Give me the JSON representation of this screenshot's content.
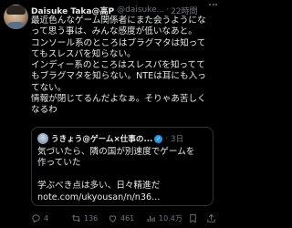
{
  "post": {
    "author_name": "Daisuke Taka@高P",
    "handle": "@daisuke...",
    "separator": "·",
    "time": "22時間",
    "lines": [
      "最近色んなゲーム関係者にまた会うようにな",
      "って思う事は、みんな感度が低いなあと。",
      "コンソール系のところはブラグマタは知って",
      "てもスレスパを知らない。",
      "インディー系のところはスレスパを知ってて",
      "もブラグマタを知らない。NTEは耳にも入っ",
      "てない。",
      "情報が閉じてるんだよなぁ。そりゃあ苦しく",
      "なるわ"
    ]
  },
  "quote": {
    "author_name": "うきょう@ゲーム×仕事の...",
    "separator": "·",
    "time": "3日",
    "lines": [
      "気づいたら、隣の国が別速度でゲームを",
      "作っていた",
      "",
      "学ぶべき点は多い、日々精進だ",
      "note.com/ukyousan/n/n36..."
    ]
  },
  "actions": {
    "reply_count": "4",
    "retweet_count": "136",
    "like_count": "461",
    "views_count": "10.4万"
  },
  "colors": {
    "background": "#000000",
    "text": "#e7e9ea",
    "muted": "#71767b",
    "border": "#2f3336",
    "verified": "#1d9bf0"
  },
  "icons": [
    "more-icon",
    "reply-icon",
    "retweet-icon",
    "like-icon",
    "views-icon",
    "bookmark-icon",
    "share-icon",
    "verified-badge-icon"
  ]
}
